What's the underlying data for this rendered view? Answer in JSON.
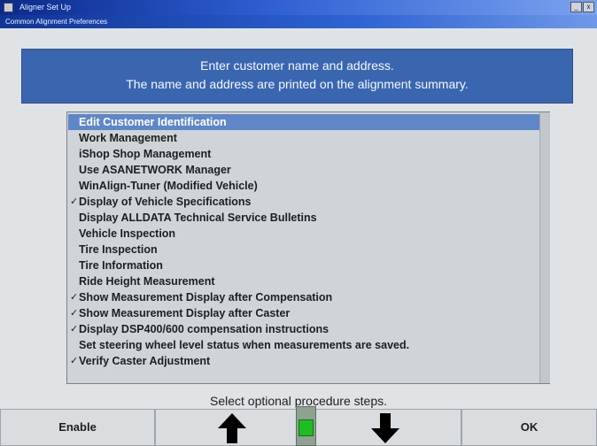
{
  "window": {
    "title": "Aligner Set Up",
    "icon": "app-icon",
    "subtitle": "Common Alignment Preferences",
    "controls": [
      "minimize",
      "close"
    ]
  },
  "info_panel": {
    "line1": "Enter customer name and address.",
    "line2": "The name and address are printed on the alignment summary."
  },
  "options_list": [
    {
      "label": "Edit Customer Identification",
      "checked": false,
      "selected": true
    },
    {
      "label": "Work Management",
      "checked": false
    },
    {
      "label": "iShop Shop Management",
      "checked": false
    },
    {
      "label": "Use ASANETWORK Manager",
      "checked": false
    },
    {
      "label": "WinAlign-Tuner (Modified Vehicle)",
      "checked": false
    },
    {
      "label": "Display of Vehicle Specifications",
      "checked": true
    },
    {
      "label": "Display ALLDATA Technical Service Bulletins",
      "checked": false
    },
    {
      "label": "Vehicle Inspection",
      "checked": false
    },
    {
      "label": "Tire Inspection",
      "checked": false
    },
    {
      "label": "Tire Information",
      "checked": false
    },
    {
      "label": "Ride Height Measurement",
      "checked": false
    },
    {
      "label": "Show Measurement Display after Compensation",
      "checked": true
    },
    {
      "label": "Show Measurement Display after Caster",
      "checked": true
    },
    {
      "label": "Display DSP400/600 compensation instructions",
      "checked": true
    },
    {
      "label": "Set steering wheel level status when measurements are saved.",
      "checked": false
    },
    {
      "label": "Verify Caster Adjustment",
      "checked": true
    }
  ],
  "check_glyph": "✓",
  "status": "Select optional procedure steps.",
  "softkeys": {
    "enable": "Enable",
    "up": "up-arrow-icon",
    "down": "down-arrow-icon",
    "ok": "OK"
  },
  "colors": {
    "title_bar": "#1f4fc4",
    "info_panel": "#3a66b0",
    "selected_row": "#5e86c8",
    "list_background": "#cfd4d8",
    "level_indicator": "#1fbd22"
  }
}
